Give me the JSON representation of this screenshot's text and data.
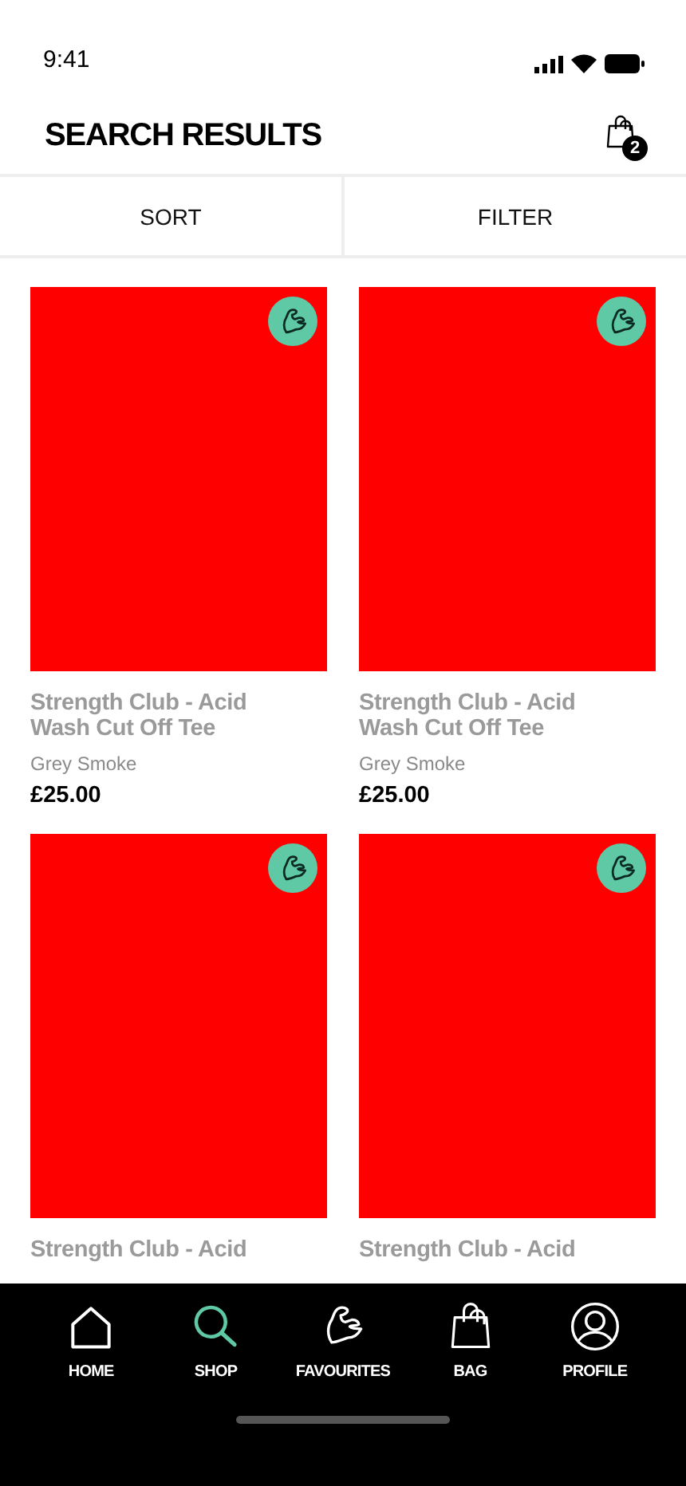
{
  "status_bar": {
    "time": "9:41"
  },
  "header": {
    "title": "SEARCH RESULTS",
    "bag_count": "2"
  },
  "toolbar": [
    "SORT",
    "FILTER"
  ],
  "products": [
    {
      "title": "Strength Club - Acid Wash Cut Off Tee",
      "variant": "Grey Smoke",
      "price": "£25.00"
    },
    {
      "title": "Strength Club - Acid Wash Cut Off Tee",
      "variant": "Grey Smoke",
      "price": "£25.00"
    },
    {
      "title": "Strength Club - Acid"
    },
    {
      "title": "Strength Club - Acid"
    }
  ],
  "tab_bar": [
    {
      "kind": "home",
      "label": "HOME",
      "selected": false
    },
    {
      "kind": "search",
      "label": "SHOP",
      "selected": true
    },
    {
      "kind": "arm",
      "label": "FAVOURITES",
      "selected": false
    },
    {
      "kind": "bag",
      "label": "BAG",
      "selected": false
    },
    {
      "kind": "profile",
      "label": "PROFILE",
      "selected": false
    }
  ]
}
